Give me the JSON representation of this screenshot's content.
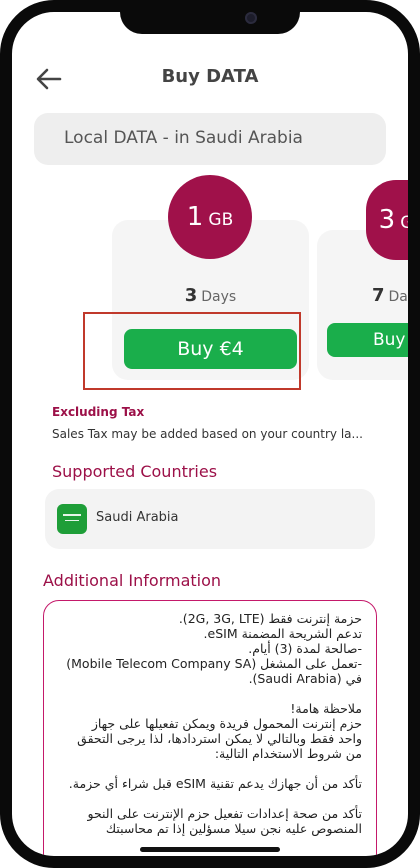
{
  "header": {
    "title": "Buy DATA",
    "back_icon": "arrow-left-icon"
  },
  "region": {
    "label": "Local DATA - in Saudi Arabia"
  },
  "plans": [
    {
      "size_value": "1",
      "size_unit": "GB",
      "days_value": "3",
      "days_unit": "Days",
      "buy_label": "Buy €4"
    },
    {
      "size_value": "3",
      "size_unit": "G",
      "days_value": "7",
      "days_unit": "Da",
      "buy_label": "Buy"
    }
  ],
  "tax": {
    "title": "Excluding Tax",
    "note": "Sales Tax may be added based on your country la..."
  },
  "supported": {
    "heading": "Supported Countries",
    "country": "Saudi Arabia",
    "flag_icon": "saudi-flag-icon"
  },
  "additional": {
    "heading": "Additional Information",
    "lines": [
      "حزمة إنترنت فقط (2G, 3G, LTE).",
      "تدعم الشريحة المضمنة eSIM.",
      "-صالحة لمدة (3) أيام.",
      "-تعمل على المشغل (Mobile Telecom Company SA)",
      "في (Saudi Arabia).",
      "",
      "ملاحظة هامة!",
      "حزم إنترنت المحمول فريدة ويمكن تفعيلها على جهاز",
      "واحد فقط وبالتالي لا يمكن استردادها، لذا يرجى التحقق",
      "من شروط الاستخدام التالية:",
      "",
      "تأكد من أن جهازك يدعم تقنية eSIM قبل شراء أي حزمة.",
      "",
      "تأكد من صحة إعدادات تفعيل حزم الإنترنت على النحو",
      "المنصوص عليه نجن سيلا مسؤلين إذا تم محاسبتك"
    ]
  },
  "colors": {
    "accent": "#9c1048",
    "buy": "#1aae4b",
    "highlight": "#c0392b"
  }
}
